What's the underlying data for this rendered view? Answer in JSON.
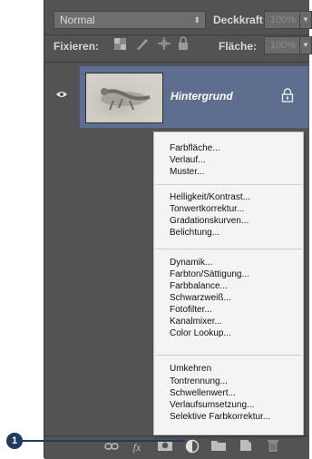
{
  "header": {
    "blend_mode": "Normal",
    "opacity_label": "Deckkraft:",
    "opacity_value": "100%",
    "lock_label": "Fixieren:",
    "fill_label": "Fläche:",
    "fill_value": "100%"
  },
  "layer": {
    "name": "Hintergrund"
  },
  "menu": {
    "groups": [
      [
        "Farbfläche...",
        "Verlauf...",
        "Muster..."
      ],
      [
        "Helligkeit/Kontrast...",
        "Tonwertkorrektur...",
        "Gradationskurven...",
        "Belichtung..."
      ],
      [
        "Dynamik...",
        "Farbton/Sättigung...",
        "Farbbalance...",
        "Schwarzweiß...",
        "Fotofilter...",
        "Kanalmixer...",
        "Color Lookup..."
      ],
      [
        "Umkehren",
        "Tontrennung...",
        "Schwellenwert...",
        "Verlaufsumsetzung...",
        "Selektive Farbkorrektur..."
      ]
    ]
  },
  "callout": {
    "number": "1"
  },
  "bottom_icons": [
    "link-icon",
    "fx-icon",
    "mask-icon",
    "adjustment-layer-icon",
    "folder-icon",
    "new-layer-icon",
    "trash-icon"
  ],
  "colors": {
    "panel": "#535353",
    "selection": "#5e6e8e",
    "callout": "#1f3b62"
  }
}
